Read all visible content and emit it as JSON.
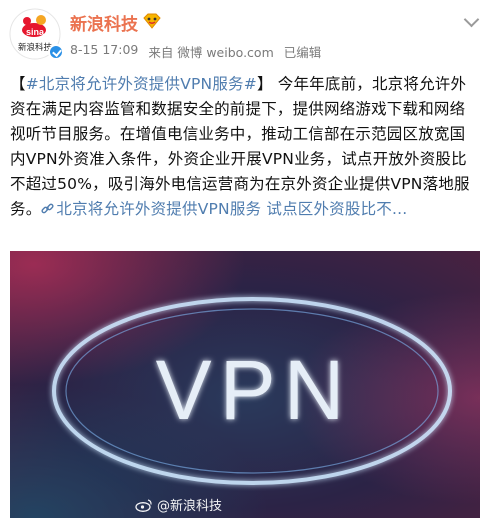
{
  "account": {
    "name": "新浪科技",
    "avatar_label_top": "sina",
    "avatar_label_bottom": "新浪科技"
  },
  "meta": {
    "time": "8-15 17:09",
    "source": "来自 微博 weibo.com",
    "edited": "已编辑"
  },
  "post": {
    "open_bracket": "【",
    "hashtag": "#北京将允许外资提供VPN服务#",
    "close_bracket": "】",
    "body": "今年年底前，北京将允许外资在满足内容监管和数据安全的前提下，提供网络游戏下载和网络视听节目服务。在增值电信业务中，推动工信部在示范园区放宽国内VPN外资准入条件，外资企业开展VPN业务，试点开放外资股比不超过50%，吸引海外电信运营商为在京外资企业提供VPN落地服务。",
    "link_text": "北京将允许外资提供VPN服务 试点区外资股比不..."
  },
  "media": {
    "image_text": "VPN",
    "watermark": "@新浪科技"
  },
  "colors": {
    "username": "#eb7350",
    "link": "#507daf",
    "verified": "#2a90e6"
  },
  "icons": {
    "verified": "verified-icon",
    "vip": "vip-badge-icon",
    "link": "link-icon",
    "menu": "chevron-down-icon"
  }
}
